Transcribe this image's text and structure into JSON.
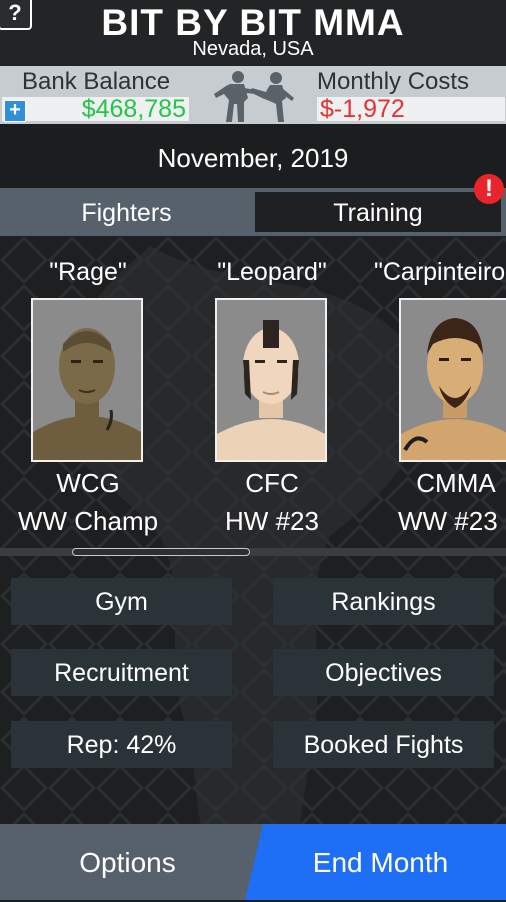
{
  "header": {
    "help_label": "?",
    "title": "BIT BY BIT MMA",
    "location": "Nevada, USA"
  },
  "finance": {
    "bank_label": "Bank Balance",
    "bank_value": "$468,785",
    "add_label": "+",
    "costs_label": "Monthly Costs",
    "costs_value": "$-1,972",
    "colors": {
      "bank": "#25c44a",
      "costs": "#e53232"
    }
  },
  "date": "November, 2019",
  "tabs": {
    "fighters": "Fighters",
    "training": "Training",
    "alert": "!"
  },
  "fighters": [
    {
      "nickname": "\"Rage\"",
      "org": "WCG",
      "rank": "WW Champ"
    },
    {
      "nickname": "\"Leopard\"",
      "org": "CFC",
      "rank": "HW #23"
    },
    {
      "nickname": "\"Carpinteiro\"",
      "org": "CMMA",
      "rank": "WW #23"
    }
  ],
  "menu": {
    "gym": "Gym",
    "rankings": "Rankings",
    "recruitment": "Recruitment",
    "objectives": "Objectives",
    "rep": "Rep: 42%",
    "booked_fights": "Booked Fights"
  },
  "footer": {
    "options": "Options",
    "end_month": "End Month"
  },
  "colors": {
    "accent": "#1e6ff5",
    "panel": "#56616b",
    "button": "#2a3337"
  }
}
